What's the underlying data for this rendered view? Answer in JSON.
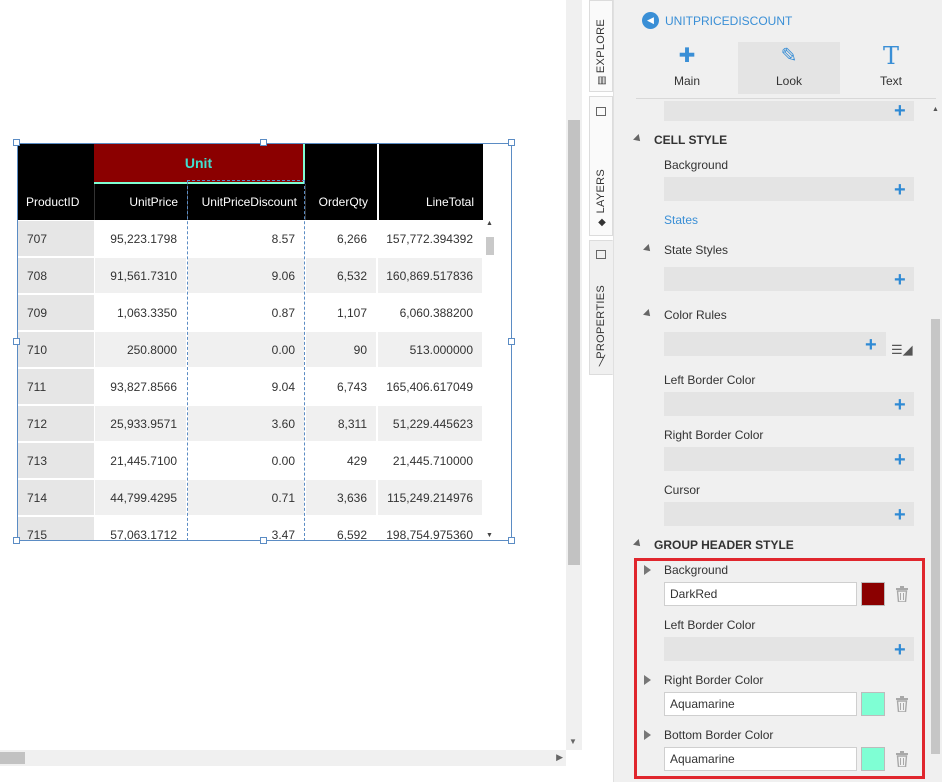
{
  "table": {
    "group_header": "Unit",
    "columns": [
      "ProductID",
      "UnitPrice",
      "UnitPriceDiscount",
      "OrderQty",
      "LineTotal"
    ],
    "rows": [
      [
        "707",
        "95,223.1798",
        "8.57",
        "6,266",
        "157,772.394392"
      ],
      [
        "708",
        "91,561.7310",
        "9.06",
        "6,532",
        "160,869.517836"
      ],
      [
        "709",
        "1,063.3350",
        "0.87",
        "1,107",
        "6,060.388200"
      ],
      [
        "710",
        "250.8000",
        "0.00",
        "90",
        "513.000000"
      ],
      [
        "711",
        "93,827.8566",
        "9.04",
        "6,743",
        "165,406.617049"
      ],
      [
        "712",
        "25,933.9571",
        "3.60",
        "8,311",
        "51,229.445623"
      ],
      [
        "713",
        "21,445.7100",
        "0.00",
        "429",
        "21,445.710000"
      ],
      [
        "714",
        "44,799.4295",
        "0.71",
        "3,636",
        "115,249.214976"
      ],
      [
        "715",
        "57,063.1712",
        "3.47",
        "6,592",
        "198,754.975360"
      ]
    ]
  },
  "side_tabs": {
    "explore": "EXPLORE",
    "layers": "LAYERS",
    "properties": "PROPERTIES"
  },
  "panel": {
    "title": "UNITPRICEDISCOUNT",
    "tabs": [
      {
        "label": "Main",
        "icon": "puzzle-icon"
      },
      {
        "label": "Look",
        "icon": "brush-icon"
      },
      {
        "label": "Text",
        "icon": "text-t-icon"
      }
    ],
    "active_tab": "Look",
    "cell_style": {
      "heading": "CELL STYLE",
      "background_label": "Background",
      "states_link": "States",
      "state_styles_label": "State Styles",
      "color_rules_label": "Color Rules",
      "left_border_label": "Left Border Color",
      "right_border_label": "Right Border Color",
      "cursor_label": "Cursor"
    },
    "group_header_style": {
      "heading": "GROUP HEADER STYLE",
      "background_label": "Background",
      "background_value": "DarkRed",
      "background_color": "#8b0000",
      "left_border_label": "Left Border Color",
      "right_border_label": "Right Border Color",
      "right_border_value": "Aquamarine",
      "right_border_color": "#7fffd4",
      "bottom_border_label": "Bottom Border Color",
      "bottom_border_value": "Aquamarine",
      "bottom_border_color": "#7fffd4"
    }
  },
  "colors": {
    "accent": "#3a8fd6",
    "header_bg": "#000000",
    "group_header_bg": "#8b0000",
    "group_header_text": "#40e0d0",
    "highlight": "#e0262d"
  }
}
